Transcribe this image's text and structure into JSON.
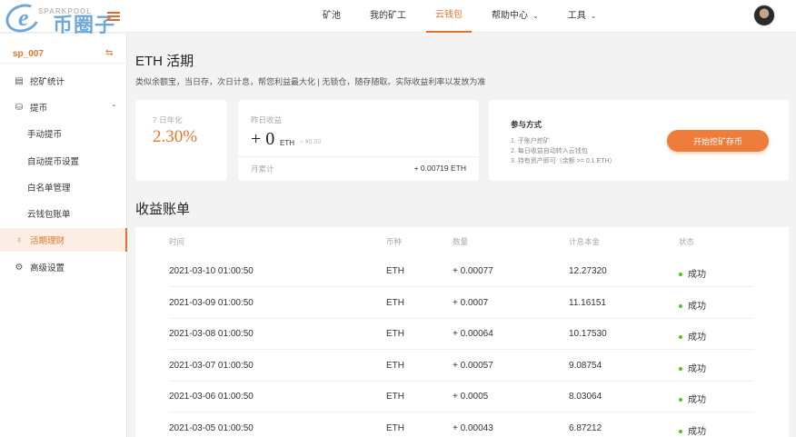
{
  "logo": {
    "brand_small": "SPARKPOOL",
    "brand_big": "币圈子",
    "e_glyph": "e"
  },
  "nav": {
    "items": [
      {
        "label": "矿池",
        "active": false,
        "dropdown": false
      },
      {
        "label": "我的矿工",
        "active": false,
        "dropdown": false
      },
      {
        "label": "云钱包",
        "active": true,
        "dropdown": false
      },
      {
        "label": "帮助中心",
        "active": false,
        "dropdown": true
      },
      {
        "label": "工具",
        "active": false,
        "dropdown": true
      }
    ],
    "chevron": "⌄"
  },
  "sidebar": {
    "account": "sp_007",
    "switch_icon": "⇆",
    "items": [
      {
        "label": "挖矿统计",
        "icon": "chart-icon",
        "glyph": "▤",
        "type": "top"
      },
      {
        "label": "提币",
        "icon": "coin-stack-icon",
        "glyph": "⛁",
        "type": "top",
        "expanded": true,
        "caret": "⌃"
      },
      {
        "label": "手动提币",
        "type": "sub"
      },
      {
        "label": "自动提币设置",
        "type": "sub"
      },
      {
        "label": "白名单管理",
        "type": "sub"
      },
      {
        "label": "云钱包账单",
        "type": "sub"
      },
      {
        "label": "活期理财",
        "icon": "money-bag-icon",
        "glyph": "♁",
        "type": "top",
        "active": true
      },
      {
        "label": "高级设置",
        "icon": "gear-icon",
        "glyph": "⚙",
        "type": "top"
      }
    ]
  },
  "main": {
    "title": "ETH 活期",
    "description": "类似余额宝，当日存，次日计息，帮您利益最大化 | 无锁仓，随存随取。实际收益利率以发放为准",
    "annual": {
      "label": "7 日年化",
      "value": "2.30%"
    },
    "yesterday": {
      "label": "昨日收益",
      "value": "+ 0",
      "unit": "ETH",
      "sub": "≈ ¥0.00",
      "month_label": "月累计",
      "month_value": "+ 0.00719 ETH"
    },
    "join": {
      "heading": "参与方式",
      "steps": [
        "1. 子账户挖矿",
        "2. 每日收益自动转入云钱包",
        "3. 持有资产即可（余额 >= 0.1 ETH）"
      ],
      "button": "开始挖矿存币"
    }
  },
  "ledger": {
    "title": "收益账单",
    "columns": [
      "时间",
      "币种",
      "数量",
      "计息本金",
      "状态"
    ],
    "rows": [
      {
        "time": "2021-03-10 01:00:50",
        "coin": "ETH",
        "amount": "+ 0.00077",
        "principal": "12.27320",
        "status": "成功"
      },
      {
        "time": "2021-03-09 01:00:50",
        "coin": "ETH",
        "amount": "+ 0.0007",
        "principal": "11.16151",
        "status": "成功"
      },
      {
        "time": "2021-03-08 01:00:50",
        "coin": "ETH",
        "amount": "+ 0.00064",
        "principal": "10.17530",
        "status": "成功"
      },
      {
        "time": "2021-03-07 01:00:50",
        "coin": "ETH",
        "amount": "+ 0.00057",
        "principal": "9.08754",
        "status": "成功"
      },
      {
        "time": "2021-03-06 01:00:50",
        "coin": "ETH",
        "amount": "+ 0.0005",
        "principal": "8.03064",
        "status": "成功"
      },
      {
        "time": "2021-03-05 01:00:50",
        "coin": "ETH",
        "amount": "+ 0.00043",
        "principal": "6.87212",
        "status": "成功"
      }
    ]
  },
  "colors": {
    "accent": "#e8742c",
    "success": "#52c41a",
    "brand_blue": "#6ea7d8"
  }
}
